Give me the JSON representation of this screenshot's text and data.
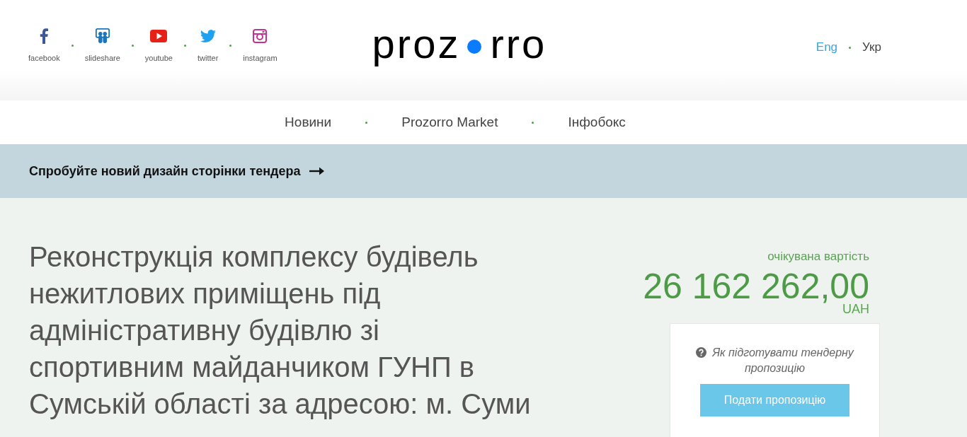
{
  "social_links": [
    {
      "kind": "facebook",
      "label": "facebook"
    },
    {
      "kind": "slideshare",
      "label": "slideshare"
    },
    {
      "kind": "youtube",
      "label": "youtube"
    },
    {
      "kind": "twitter",
      "label": "twitter"
    },
    {
      "kind": "instagram",
      "label": "instagram"
    }
  ],
  "logo": {
    "text_start": "proz",
    "text_end": "rro"
  },
  "languages": [
    {
      "label": "Eng",
      "selected": false
    },
    {
      "label": "Укр",
      "selected": true
    }
  ],
  "nav": {
    "items": [
      {
        "label": "Новини"
      },
      {
        "label": "Prozorro Market"
      },
      {
        "label": "Інфобокс"
      }
    ]
  },
  "banner": {
    "text": "Спробуйте новий дизайн сторінки тендера"
  },
  "tender": {
    "title": "Реконструкція комплексу будівель нежитлових приміщень під адміністративну будівлю зі спортивним майданчиком ГУНП в Сумській області за адресою: м. Суми",
    "expected_value": {
      "label": "очікувана вартість",
      "amount": "26 162 262,00",
      "currency": "UAH"
    },
    "help_link": "Як підготувати тендерну пропозицію",
    "submit_button": "Подати пропозицію"
  }
}
